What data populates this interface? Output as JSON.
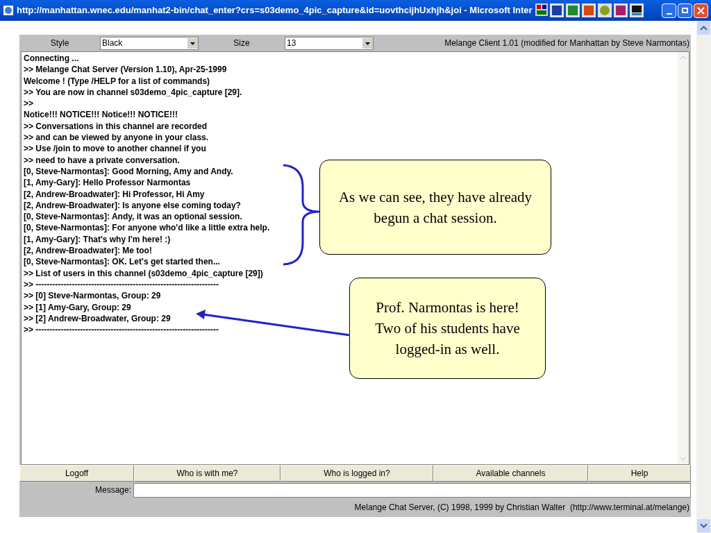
{
  "window": {
    "title": "http://manhattan.wnec.edu/manhat2-bin/chat_enter?crs=s03demo_4pic_capture&id=uovthcijhUxhjh&joi - Microsoft Inter"
  },
  "toolbar": {
    "style_label": "Style",
    "style_value": "Black",
    "size_label": "Size",
    "size_value": "13",
    "client_info": "Melange Client 1.01 (modified for Manhattan by Steve Narmontas)"
  },
  "chat": {
    "lines": [
      "Connecting ...",
      ">> Melange Chat Server (Version 1.10), Apr-25-1999",
      "Welcome ! (Type /HELP for a list of commands)",
      ">> You are now in channel s03demo_4pic_capture [29].",
      ">>",
      "Notice!!! NOTICE!!! Notice!!! NOTICE!!!",
      ">> Conversations in this channel are recorded",
      ">> and can be viewed by anyone in your class.",
      ">> Use /join to move to another channel if you",
      ">> need to have a private conversation.",
      "[0, Steve-Narmontas]: Good Morning, Amy and Andy.",
      "[1, Amy-Gary]: Hello Professor Narmontas",
      "[2, Andrew-Broadwater]: Hi Professor, Hi Amy",
      "[2, Andrew-Broadwater]: Is anyone else coming today?",
      "[0, Steve-Narmontas]: Andy, it was an optional session.",
      "[0, Steve-Narmontas]: For anyone who'd like a little extra help.",
      "[1, Amy-Gary]: That's why I'm here! :)",
      "[2, Andrew-Broadwater]: Me too!",
      "[0, Steve-Narmontas]: OK. Let's get started then...",
      ">> List of users in this channel (s03demo_4pic_capture [29])",
      ">> ------------------------------------------------------------------",
      ">> [0] Steve-Narmontas, Group: 29",
      ">> [1] Amy-Gary, Group: 29",
      ">> [2] Andrew-Broadwater, Group: 29",
      ">> ------------------------------------------------------------------"
    ]
  },
  "buttons": [
    "Logoff",
    "Who is with me?",
    "Who is logged in?",
    "Available channels",
    "Help"
  ],
  "message": {
    "label": "Message:"
  },
  "footer": "Melange Chat Server, (C) 1998, 1999 by Christian Walter  (http://www.terminal.at/melange)",
  "callouts": [
    {
      "text": "As we can see, they have already begun a chat session."
    },
    {
      "text": "Prof. Narmontas is here! Two of his students have logged-in as well."
    }
  ]
}
